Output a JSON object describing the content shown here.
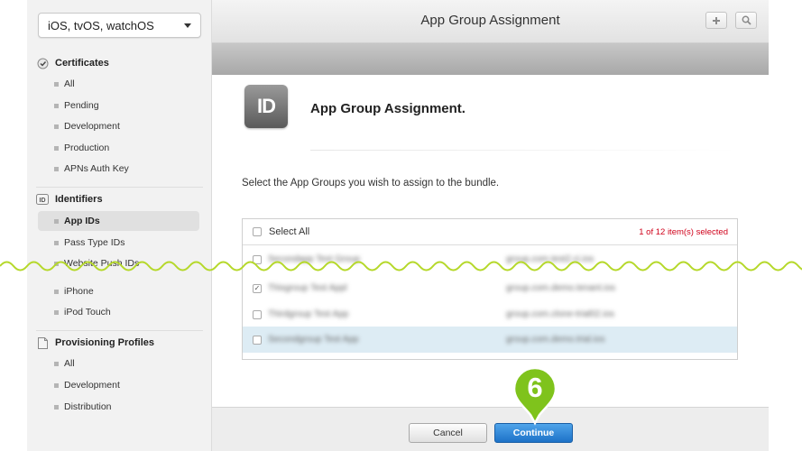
{
  "sidebar": {
    "platform_selector": "iOS, tvOS, watchOS",
    "sections": [
      {
        "title": "Certificates",
        "icon": "certificate-icon",
        "items": [
          {
            "label": "All"
          },
          {
            "label": "Pending"
          },
          {
            "label": "Development"
          },
          {
            "label": "Production"
          },
          {
            "label": "APNs Auth Key"
          }
        ]
      },
      {
        "title": "Identifiers",
        "icon": "id-badge-icon",
        "items": [
          {
            "label": "App IDs",
            "active": true
          },
          {
            "label": "Pass Type IDs"
          },
          {
            "label": "Website Push IDs"
          }
        ]
      },
      {
        "title": "",
        "items": [
          {
            "label": "iPhone"
          },
          {
            "label": "iPod Touch"
          }
        ]
      },
      {
        "title": "Provisioning Profiles",
        "icon": "document-icon",
        "items": [
          {
            "label": "All"
          },
          {
            "label": "Development"
          },
          {
            "label": "Distribution"
          }
        ]
      }
    ]
  },
  "header": {
    "title": "App Group Assignment",
    "add_icon": "plus-icon",
    "search_icon": "search-icon"
  },
  "main": {
    "icon_text": "ID",
    "heading": "App Group Assignment.",
    "instruction": "Select the App Groups you wish to assign to the bundle.",
    "table": {
      "select_all_label": "Select All",
      "selection_count": "1 of 12 item(s) selected",
      "rows": [
        {
          "name": "Secondapp Test Group",
          "group_id": "group.com.test2.ci.ios",
          "checked": false,
          "highlighted": false
        },
        {
          "name": "Thisgroup Test Appl",
          "group_id": "group.com.demo.tenant.ios",
          "checked": true,
          "highlighted": false
        },
        {
          "name": "Thirdgroup Test App",
          "group_id": "group.com.clone-trial02.ios",
          "checked": false,
          "highlighted": false
        },
        {
          "name": "Secondgroup Test App",
          "group_id": "group.com.demo.trial.ios",
          "checked": false,
          "highlighted": true
        }
      ]
    }
  },
  "footer": {
    "cancel_label": "Cancel",
    "continue_label": "Continue"
  },
  "annotation": {
    "step_number": "6",
    "marker_color": "#7fc31c"
  },
  "colors": {
    "accent_blue": "#1d72c8",
    "selection_count_red": "#d0021b",
    "highlight_row": "#ddecf4"
  }
}
